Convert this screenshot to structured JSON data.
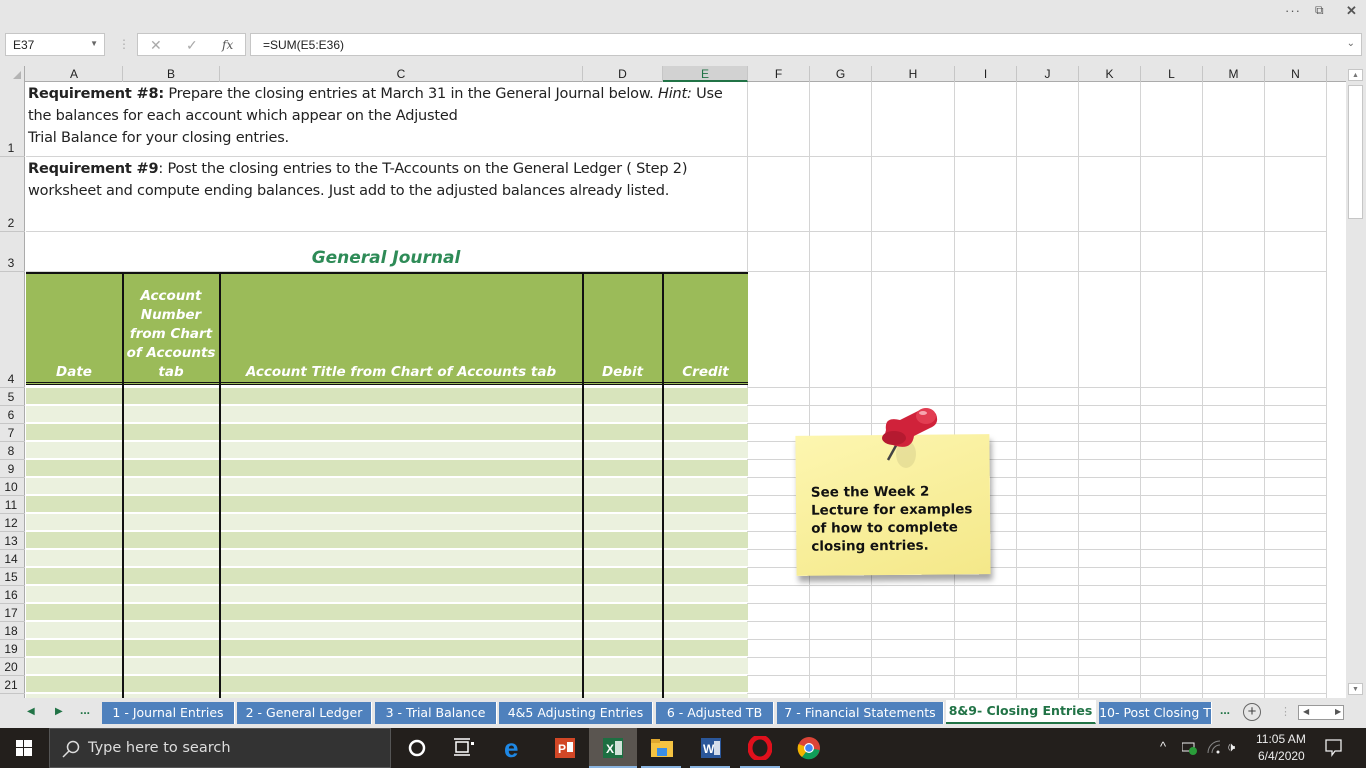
{
  "window": {
    "more_label": "···",
    "restore_label": "⧉",
    "close_label": "✕"
  },
  "formula_bar": {
    "name_box": "E37",
    "cancel_icon": "✕",
    "enter_icon": "✓",
    "fx_label": "fx",
    "formula": "=SUM(E5:E36)"
  },
  "columns": [
    "A",
    "B",
    "C",
    "D",
    "E",
    "F",
    "G",
    "H",
    "I",
    "J",
    "K",
    "L",
    "M",
    "N"
  ],
  "selected_column": "E",
  "rows": [
    "1",
    "2",
    "3",
    "4",
    "5",
    "6",
    "7",
    "8",
    "9",
    "10",
    "11",
    "12",
    "13",
    "14",
    "15",
    "16",
    "17",
    "18",
    "19",
    "20",
    "21"
  ],
  "requirement8": {
    "bold": "Requirement #8:",
    "line1": " Prepare the closing entries at March 31 in the General Journal below. ",
    "hint_label": "Hint:",
    "line1_end": " Use",
    "line2": "the balances for each account which appear on the Adjusted",
    "line3": "Trial Balance for your closing entries."
  },
  "requirement9": {
    "bold": "Requirement #9",
    "line1": ": Post the closing entries to the T-Accounts on the General Ledger  ( Step 2)",
    "line2": "worksheet and compute ending balances. Just add to the adjusted balances already listed."
  },
  "journal": {
    "title": "General Journal",
    "headers": {
      "date": "Date",
      "account_number": "Account Number from Chart of Accounts tab",
      "account_title": "Account Title from Chart of Accounts tab",
      "debit": "Debit",
      "credit": "Credit"
    },
    "colors": {
      "header": "#9bbb59",
      "band_dark": "#d8e4bc",
      "band_light": "#ebf1de",
      "title": "#2e8b57"
    }
  },
  "sticky_note": {
    "text": "See the Week 2 Lecture for examples of how to complete closing entries.",
    "icon": "pushpin-icon"
  },
  "sheet_tabs": [
    {
      "label": "1 - Journal Entries",
      "active": false
    },
    {
      "label": "2 - General Ledger",
      "active": false
    },
    {
      "label": "3 - Trial Balance",
      "active": false
    },
    {
      "label": "4&5 Adjusting Entries",
      "active": false
    },
    {
      "label": "6 - Adjusted TB",
      "active": false
    },
    {
      "label": "7 - Financial Statements",
      "active": false
    },
    {
      "label": "8&9- Closing Entries",
      "active": true
    },
    {
      "label": "10- Post Closing T",
      "active": false
    }
  ],
  "tab_nav": {
    "prev": "◀",
    "next": "▶",
    "more": "...",
    "more_right": "...",
    "add": "+"
  },
  "taskbar": {
    "search_placeholder": "Type here to search",
    "time": "11:05 AM",
    "date": "6/4/2020"
  }
}
